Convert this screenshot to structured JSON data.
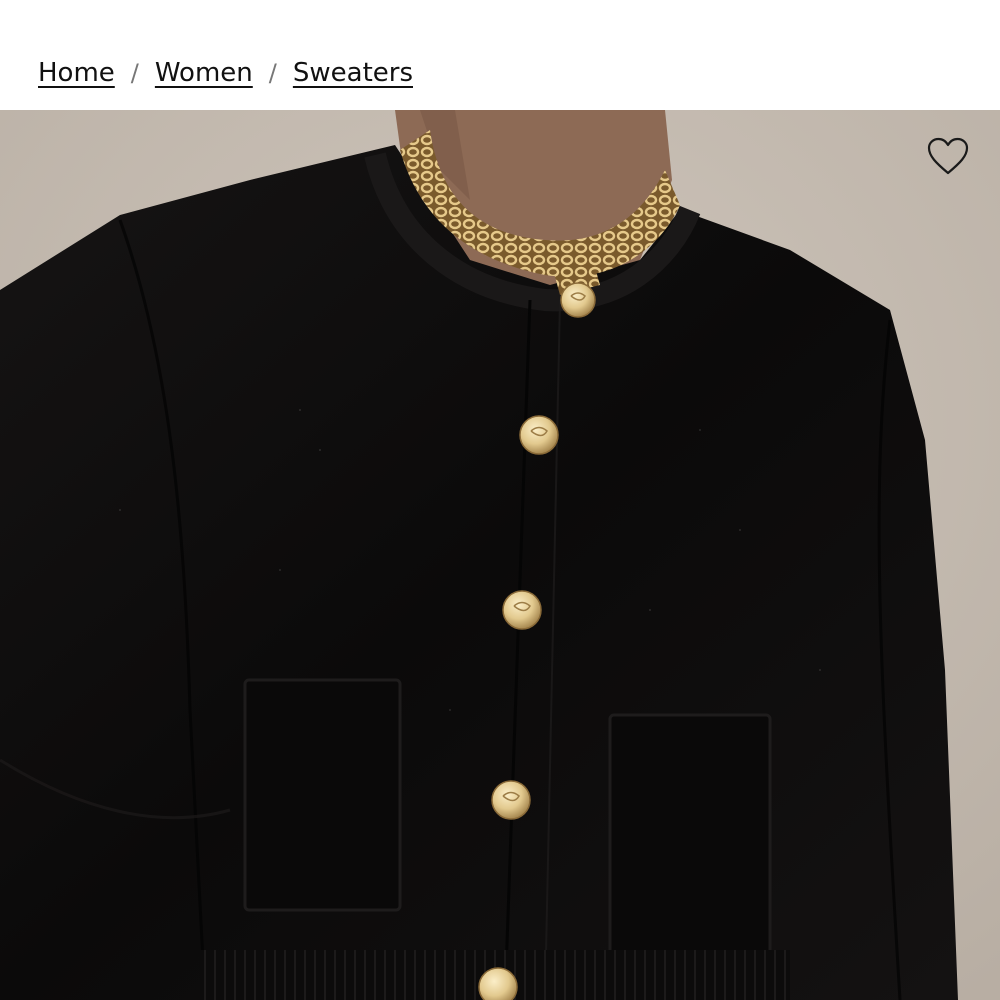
{
  "breadcrumb": {
    "items": [
      {
        "label": "Home"
      },
      {
        "label": "Women"
      },
      {
        "label": "Sweaters"
      }
    ],
    "separator": "/"
  },
  "product_image": {
    "subject": "black knit cardigan with gold buttons and gold chain collar",
    "colors": {
      "background": "#c4bbb1",
      "garment": "#0e0d0d",
      "skin": "#8d6a55",
      "gold": "#d9b776"
    }
  },
  "actions": {
    "favorite_icon": "heart-outline-icon"
  }
}
